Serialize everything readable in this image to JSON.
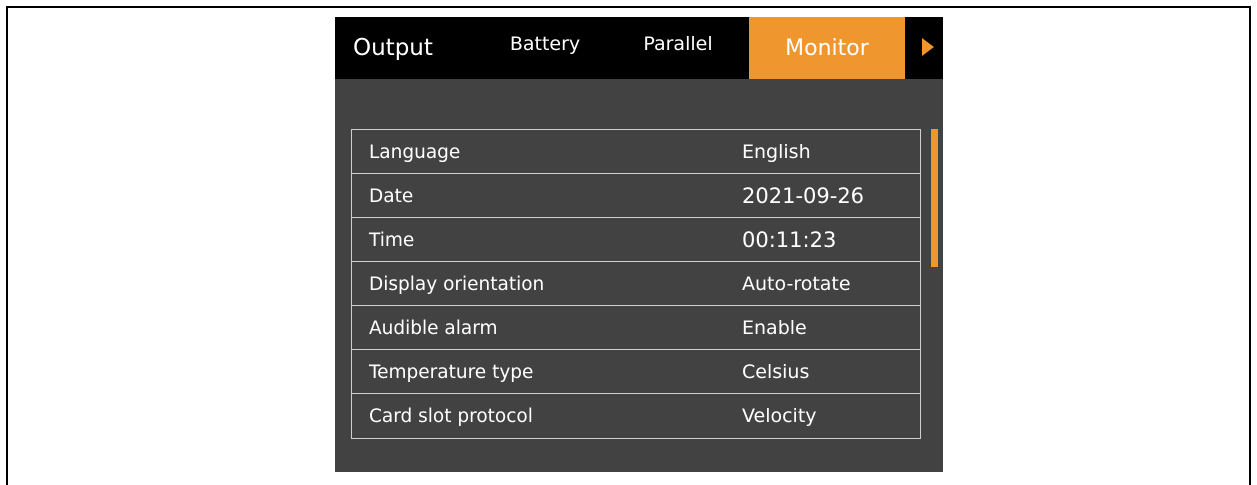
{
  "tabs": [
    {
      "label": "Output"
    },
    {
      "label": "Battery"
    },
    {
      "label": "Parallel"
    },
    {
      "label": "Monitor",
      "active": true
    }
  ],
  "settings": [
    {
      "label": "Language",
      "value": "English"
    },
    {
      "label": "Date",
      "value": "2021-09-26"
    },
    {
      "label": "Time",
      "value": "00:11:23"
    },
    {
      "label": "Display orientation",
      "value": "Auto-rotate"
    },
    {
      "label": "Audible alarm",
      "value": "Enable"
    },
    {
      "label": "Temperature type",
      "value": "Celsius"
    },
    {
      "label": "Card slot protocol",
      "value": "Velocity"
    }
  ],
  "icons": {
    "next_tab": "play-arrow-icon"
  },
  "colors": {
    "accent": "#f0962f",
    "panel": "#424242",
    "tabbar": "#000000"
  }
}
